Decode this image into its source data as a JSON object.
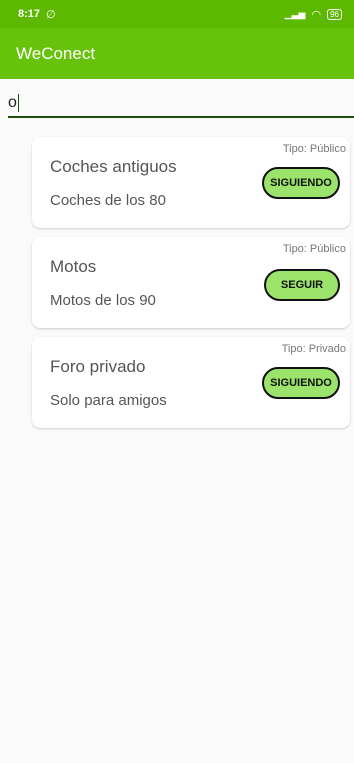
{
  "status_bar": {
    "time": "8:17",
    "left_icon": "no-alarm-icon",
    "signal": "▁▃▅",
    "wifi": "◠",
    "battery": "96"
  },
  "app_bar": {
    "title": "WeConect"
  },
  "search": {
    "value": "o"
  },
  "results": [
    {
      "title": "Coches antiguos",
      "subtitle": "Coches de los 80",
      "tipo": "Tipo: Público",
      "button": "SIGUIENDO"
    },
    {
      "title": "Motos",
      "subtitle": "Motos de los 90",
      "tipo": "Tipo: Público",
      "button": "SEGUIR"
    },
    {
      "title": "Foro privado",
      "subtitle": "Solo para amigos",
      "tipo": "Tipo: Privado",
      "button": "SIGUIENDO"
    }
  ],
  "colors": {
    "status_bar": "#5cb800",
    "app_bar": "#66c20a",
    "button_fill": "#9be36a"
  }
}
